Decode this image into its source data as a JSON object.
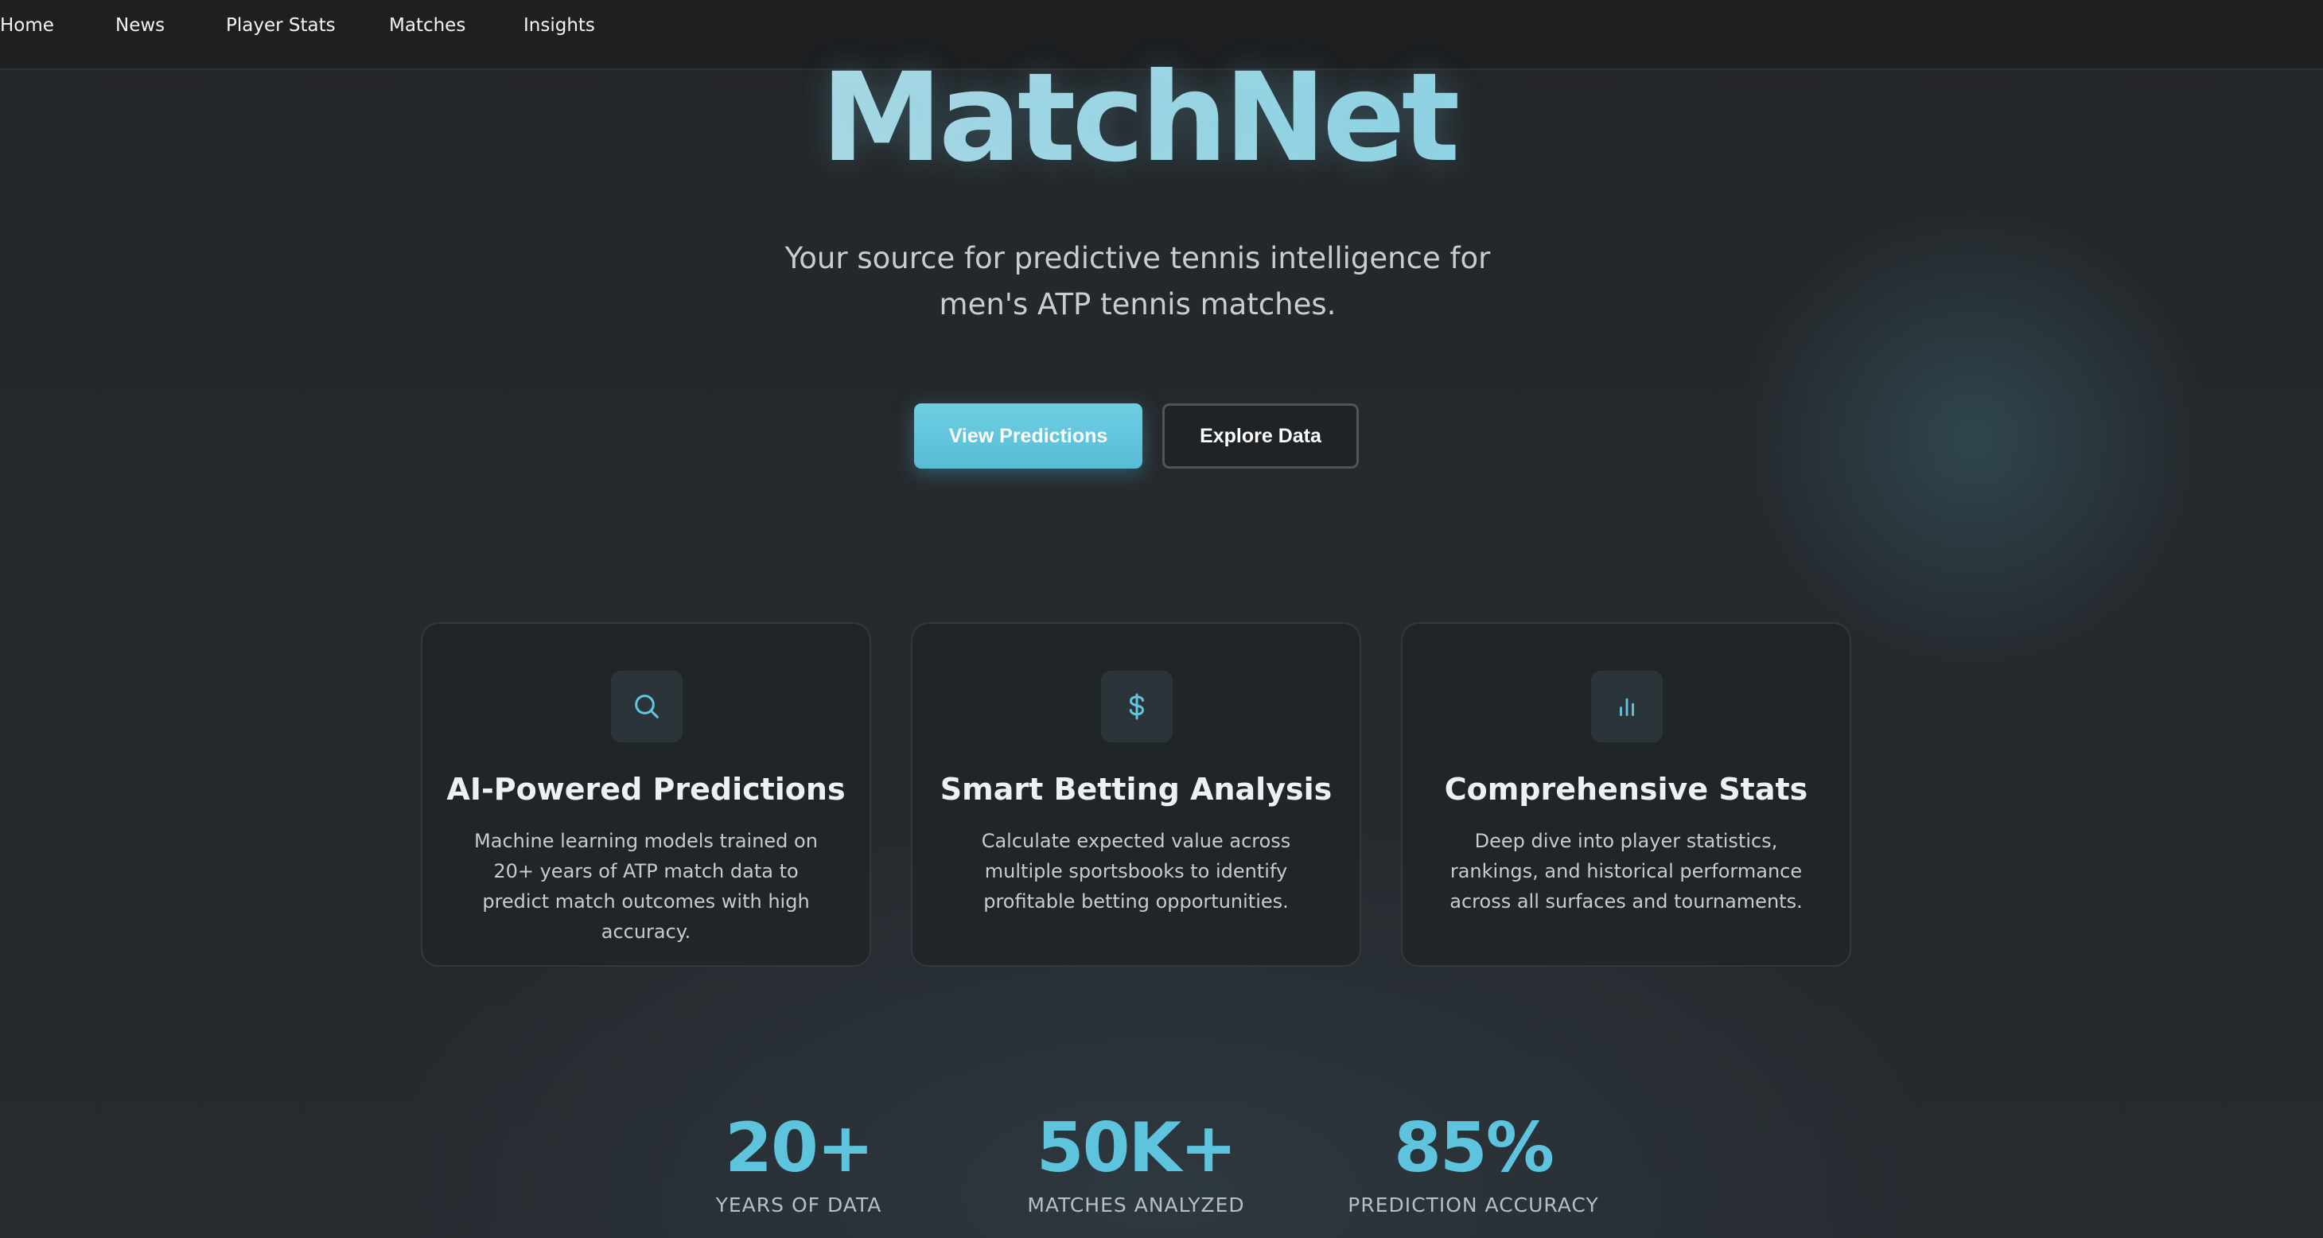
{
  "nav": {
    "items": [
      {
        "label": "Home"
      },
      {
        "label": "News"
      },
      {
        "label": "Player Stats"
      },
      {
        "label": "Matches"
      },
      {
        "label": "Insights"
      }
    ]
  },
  "hero": {
    "title": "MatchNet",
    "subtitle": "Your source for predictive tennis intelligence for men's ATP tennis matches.",
    "primary_button": "View Predictions",
    "secondary_button": "Explore Data"
  },
  "features": [
    {
      "icon": "search-icon",
      "title": "AI-Powered Predictions",
      "description": "Machine learning models trained on 20+ years of ATP match data to predict match outcomes with high accuracy."
    },
    {
      "icon": "dollar-icon",
      "title": "Smart Betting Analysis",
      "description": "Calculate expected value across multiple sportsbooks to identify profitable betting opportunities."
    },
    {
      "icon": "bar-chart-icon",
      "title": "Comprehensive Stats",
      "description": "Deep dive into player statistics, rankings, and historical performance across all surfaces and tournaments."
    }
  ],
  "stats": [
    {
      "value": "20+",
      "label": "YEARS OF DATA"
    },
    {
      "value": "50K+",
      "label": "MATCHES ANALYZED"
    },
    {
      "value": "85%",
      "label": "PREDICTION ACCURACY"
    }
  ],
  "colors": {
    "accent": "#5ec3dc",
    "background": "#25292d",
    "nav_background": "#1d1f21"
  }
}
